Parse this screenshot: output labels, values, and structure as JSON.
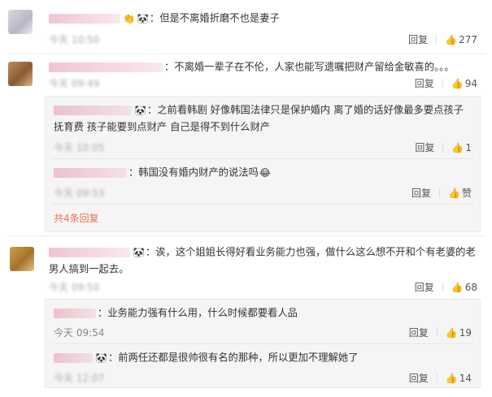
{
  "comments": [
    {
      "text": "：但是不离婚折磨不也是妻子",
      "time": "今天 10:50",
      "reply_label": "回复",
      "like_count": "277"
    },
    {
      "text": "：不离婚一辈子在不伦，人家也能写遗嘱把财产留给金敏喜的。。。",
      "time": "今天 09:49",
      "reply_label": "回复",
      "like_count": "94",
      "replies": [
        {
          "text": "：之前看韩剧 好像韩国法律只是保护婚内 离了婚的话好像最多要点孩子抚育费 孩子能要到点财产 自己是得不到什么财产",
          "time": "今天 10:05",
          "reply_label": "回复",
          "like_count": "1"
        },
        {
          "text": "：韩国没有婚内财产的说法吗",
          "time": "今天 09:53",
          "reply_label": "回复",
          "like_count": "赞"
        }
      ],
      "more_replies": "共4条回复"
    },
    {
      "text": "：诶，这个姐姐长得好看业务能力也强，做什么这么想不开和个有老婆的老男人搞到一起去。",
      "time": "今天 09:50",
      "reply_label": "回复",
      "like_count": "68",
      "replies": [
        {
          "text": "：业务能力强有什么用，什么时候都要看人品",
          "time": "今天 09:54",
          "reply_label": "回复",
          "like_count": "19"
        },
        {
          "text": "：前两任还都是很帅很有名的那种，所以更加不理解她了",
          "time": "今天 12:07",
          "reply_label": "回复",
          "like_count": "14"
        }
      ]
    }
  ],
  "icons": {
    "like": "thumbs-up-icon",
    "emoji_face": "panda-face-emoji",
    "emoji_hands": "clapping-hands-emoji",
    "emoji_laugh": "laughing-face-emoji"
  },
  "colors": {
    "link_orange": "#eb7350",
    "meta_gray": "#999999",
    "reply_bg": "#f5f5f5"
  }
}
